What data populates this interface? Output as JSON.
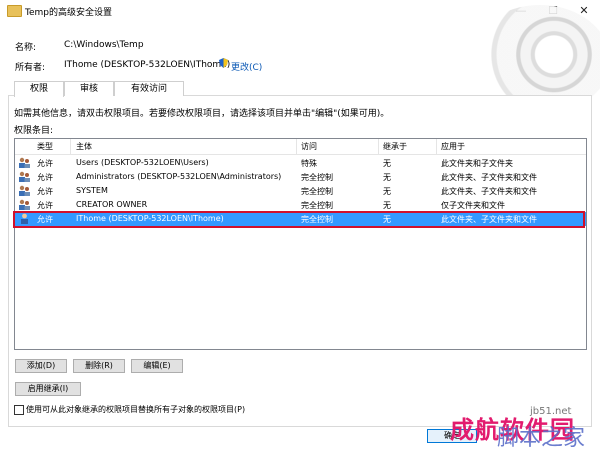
{
  "window": {
    "title": "Temp的高级安全设置",
    "controls": {
      "minimize": "—",
      "maximize": "☐",
      "close": "✕"
    }
  },
  "info": {
    "name_label": "名称:",
    "name_value": "C:\\Windows\\Temp",
    "owner_label": "所有者:",
    "owner_value": "IThome (DESKTOP-532LOEN\\IThome)",
    "change_link": "更改(C)"
  },
  "tabs": [
    {
      "label": "权限",
      "active": true
    },
    {
      "label": "审核",
      "active": false
    },
    {
      "label": "有效访问",
      "active": false
    }
  ],
  "hint": "如需其他信息，请双击权限项目。若要修改权限项目，请选择该项目并单击\"编辑\"(如果可用)。",
  "list_title": "权限条目:",
  "columns": [
    "类型",
    "主体",
    "访问",
    "继承于",
    "应用于"
  ],
  "entries": [
    {
      "type": "允许",
      "principal": "Users (DESKTOP-532LOEN\\Users)",
      "access": "特殊",
      "inherited": "无",
      "applies": "此文件夹和子文件夹",
      "selected": false
    },
    {
      "type": "允许",
      "principal": "Administrators (DESKTOP-532LOEN\\Administrators)",
      "access": "完全控制",
      "inherited": "无",
      "applies": "此文件夹、子文件夹和文件",
      "selected": false
    },
    {
      "type": "允许",
      "principal": "SYSTEM",
      "access": "完全控制",
      "inherited": "无",
      "applies": "此文件夹、子文件夹和文件",
      "selected": false
    },
    {
      "type": "允许",
      "principal": "CREATOR OWNER",
      "access": "完全控制",
      "inherited": "无",
      "applies": "仅子文件夹和文件",
      "selected": false
    },
    {
      "type": "允许",
      "principal": "IThome (DESKTOP-532LOEN\\IThome)",
      "access": "完全控制",
      "inherited": "无",
      "applies": "此文件夹、子文件夹和文件",
      "selected": true
    }
  ],
  "buttons": {
    "add": "添加(D)",
    "remove": "删除(R)",
    "edit": "编辑(E)",
    "enable_inheritance": "启用继承(I)",
    "ok": "确定"
  },
  "replace_checkbox_label": "使用可从此对象继承的权限项目替换所有子对象的权限项目(P)",
  "watermark": {
    "line1": "成航软件园",
    "line2": "jb51.net",
    "line3": "脚本之家"
  },
  "colors": {
    "selection": "#3399ff",
    "highlight_outline": "#d0102b",
    "link": "#0a58b5"
  }
}
